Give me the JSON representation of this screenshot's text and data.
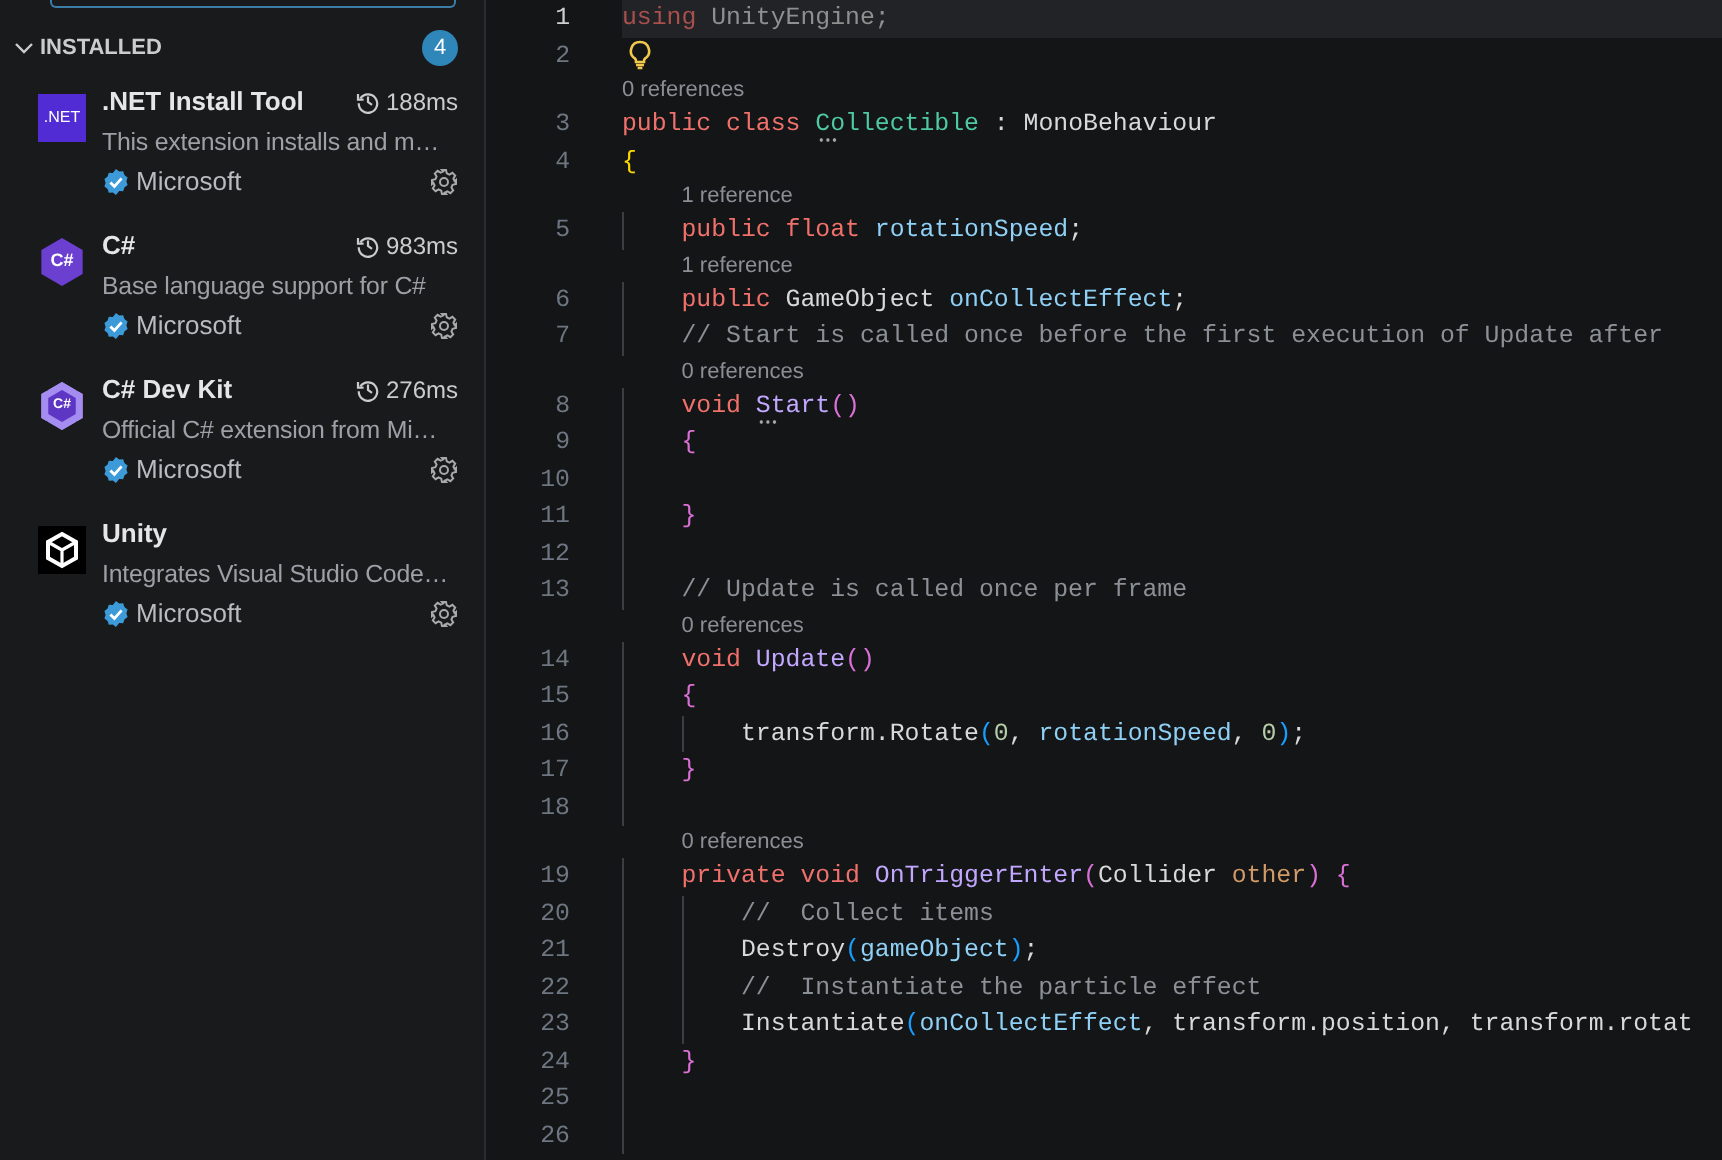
{
  "sidebar": {
    "section": {
      "title": "INSTALLED",
      "expanded": true,
      "count": "4"
    },
    "extensions": [
      {
        "name": ".NET Install Tool",
        "time": "188ms",
        "description": "This extension installs and m…",
        "publisher": "Microsoft",
        "logo": {
          "kind": "square",
          "label": ".NET"
        }
      },
      {
        "name": "C#",
        "time": "983ms",
        "description": "Base language support for C#",
        "publisher": "Microsoft",
        "logo": {
          "kind": "hexagon",
          "label": "C#"
        }
      },
      {
        "name": "C# Dev Kit",
        "time": "276ms",
        "description": "Official C# extension from Mi…",
        "publisher": "Microsoft",
        "logo": {
          "kind": "hexagon-ring",
          "label": "C#"
        }
      },
      {
        "name": "Unity",
        "description": "Integrates Visual Studio Code…",
        "publisher": "Microsoft",
        "logo": {
          "kind": "cube"
        }
      }
    ]
  },
  "editor": {
    "rows": [
      {
        "kind": "code",
        "number": "1",
        "current": true,
        "tokens": [
          {
            "text": "using",
            "kind": "faded-keyword"
          },
          {
            "text": " UnityEngine;",
            "kind": "faded"
          }
        ]
      },
      {
        "kind": "code",
        "number": "2",
        "current": false,
        "lightbulb": true
      },
      {
        "kind": "lens",
        "text": "0 references"
      },
      {
        "kind": "code",
        "number": "3",
        "current": false,
        "tokens": [
          {
            "text": "public class ",
            "kind": "keyword"
          },
          {
            "text": "Collectible",
            "kind": "type",
            "hint": true
          },
          {
            "text": " : MonoBehaviour",
            "kind": "plain"
          }
        ]
      },
      {
        "kind": "code",
        "number": "4",
        "current": false,
        "tokens": [
          {
            "text": "{",
            "kind": "brace1"
          }
        ]
      },
      {
        "kind": "lens",
        "text": "1 reference"
      },
      {
        "kind": "code",
        "number": "5",
        "current": false,
        "tokens": [
          {
            "text": "    public float ",
            "kind": "keyword"
          },
          {
            "text": "rotationSpeed",
            "kind": "field"
          },
          {
            "text": ";",
            "kind": "plain"
          }
        ]
      },
      {
        "kind": "lens",
        "text": "1 reference"
      },
      {
        "kind": "code",
        "number": "6",
        "current": false,
        "tokens": [
          {
            "text": "    public ",
            "kind": "keyword"
          },
          {
            "text": "GameObject ",
            "kind": "plain"
          },
          {
            "text": "onCollectEffect",
            "kind": "field"
          },
          {
            "text": ";",
            "kind": "plain"
          }
        ]
      },
      {
        "kind": "code",
        "number": "7",
        "current": false,
        "tokens": [
          {
            "text": "    // Start is called once before the first execution of Update after",
            "kind": "comment"
          }
        ]
      },
      {
        "kind": "lens",
        "text": "0 references"
      },
      {
        "kind": "code",
        "number": "8",
        "current": false,
        "tokens": [
          {
            "text": "    void ",
            "kind": "keyword"
          },
          {
            "text": "Start",
            "kind": "method",
            "hint": true
          },
          {
            "text": "()",
            "kind": "brace2"
          }
        ]
      },
      {
        "kind": "code",
        "number": "9",
        "current": false,
        "tokens": [
          {
            "text": "    {",
            "kind": "brace2"
          }
        ]
      },
      {
        "kind": "code",
        "number": "10",
        "current": false
      },
      {
        "kind": "code",
        "number": "11",
        "current": false,
        "tokens": [
          {
            "text": "    }",
            "kind": "brace2"
          }
        ]
      },
      {
        "kind": "code",
        "number": "12",
        "current": false
      },
      {
        "kind": "code",
        "number": "13",
        "current": false,
        "tokens": [
          {
            "text": "    // Update is called once per frame",
            "kind": "comment"
          }
        ]
      },
      {
        "kind": "lens",
        "text": "0 references"
      },
      {
        "kind": "code",
        "number": "14",
        "current": false,
        "tokens": [
          {
            "text": "    void ",
            "kind": "keyword"
          },
          {
            "text": "Update",
            "kind": "method"
          },
          {
            "text": "()",
            "kind": "brace2"
          }
        ]
      },
      {
        "kind": "code",
        "number": "15",
        "current": false,
        "tokens": [
          {
            "text": "    {",
            "kind": "brace2"
          }
        ]
      },
      {
        "kind": "code",
        "number": "16",
        "current": false,
        "tokens": [
          {
            "text": "        transform.Rotate",
            "kind": "plain"
          },
          {
            "text": "(",
            "kind": "brace3"
          },
          {
            "text": "0",
            "kind": "number"
          },
          {
            "text": ", ",
            "kind": "plain"
          },
          {
            "text": "rotationSpeed",
            "kind": "field"
          },
          {
            "text": ", ",
            "kind": "plain"
          },
          {
            "text": "0",
            "kind": "number"
          },
          {
            "text": ")",
            "kind": "brace3"
          },
          {
            "text": ";",
            "kind": "plain"
          }
        ]
      },
      {
        "kind": "code",
        "number": "17",
        "current": false,
        "tokens": [
          {
            "text": "    }",
            "kind": "brace2"
          }
        ]
      },
      {
        "kind": "code",
        "number": "18",
        "current": false
      },
      {
        "kind": "lens",
        "text": "0 references"
      },
      {
        "kind": "code",
        "number": "19",
        "current": false,
        "tokens": [
          {
            "text": "    private void ",
            "kind": "keyword"
          },
          {
            "text": "OnTriggerEnter",
            "kind": "method"
          },
          {
            "text": "(",
            "kind": "brace2"
          },
          {
            "text": "Collider ",
            "kind": "plain"
          },
          {
            "text": "other",
            "kind": "param"
          },
          {
            "text": ") {",
            "kind": "brace2"
          }
        ]
      },
      {
        "kind": "code",
        "number": "20",
        "current": false,
        "tokens": [
          {
            "text": "        //  Collect items",
            "kind": "comment"
          }
        ]
      },
      {
        "kind": "code",
        "number": "21",
        "current": false,
        "tokens": [
          {
            "text": "        Destroy",
            "kind": "plain"
          },
          {
            "text": "(",
            "kind": "brace3"
          },
          {
            "text": "gameObject",
            "kind": "field"
          },
          {
            "text": ")",
            "kind": "brace3"
          },
          {
            "text": ";",
            "kind": "plain"
          }
        ]
      },
      {
        "kind": "code",
        "number": "22",
        "current": false,
        "tokens": [
          {
            "text": "        //  Instantiate the particle effect",
            "kind": "comment"
          }
        ]
      },
      {
        "kind": "code",
        "number": "23",
        "current": false,
        "tokens": [
          {
            "text": "        Instantiate",
            "kind": "plain"
          },
          {
            "text": "(",
            "kind": "brace3"
          },
          {
            "text": "onCollectEffect",
            "kind": "field"
          },
          {
            "text": ", transform.position, transform.rotat",
            "kind": "plain"
          }
        ]
      },
      {
        "kind": "code",
        "number": "24",
        "current": false,
        "tokens": [
          {
            "text": "    }",
            "kind": "brace2"
          }
        ]
      },
      {
        "kind": "code",
        "number": "25",
        "current": false
      },
      {
        "kind": "code",
        "number": "26",
        "current": false
      }
    ]
  }
}
